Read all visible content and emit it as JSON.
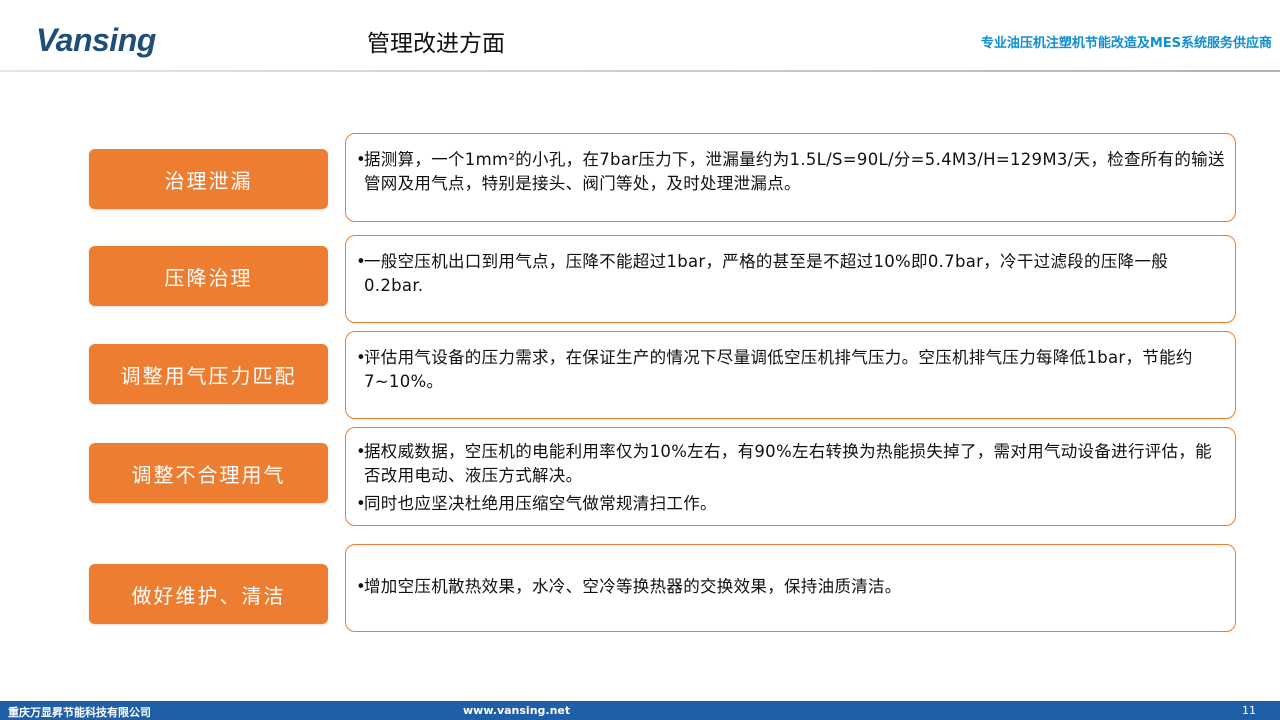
{
  "header": {
    "logo_text": "Vansing",
    "title": "管理改进方面",
    "tagline": "专业油压机注塑机节能改造及MES系统服务供应商"
  },
  "items": [
    {
      "label": "治理泄漏",
      "bullets": [
        "据测算，一个1mm²的小孔，在7bar压力下，泄漏量约为1.5L/S=90L/分=5.4M3/H=129M3/天，检查所有的输送管网及用气点，特别是接头、阀门等处，及时处理泄漏点。"
      ]
    },
    {
      "label": "压降治理",
      "bullets": [
        "一般空压机出口到用气点，压降不能超过1bar，严格的甚至是不超过10%即0.7bar，冷干过滤段的压降一般0.2bar."
      ]
    },
    {
      "label": "调整用气压力匹配",
      "bullets": [
        "评估用气设备的压力需求，在保证生产的情况下尽量调低空压机排气压力。空压机排气压力每降低1bar，节能约7~10%。"
      ]
    },
    {
      "label": "调整不合理用气",
      "bullets": [
        "据权威数据，空压机的电能利用率仅为10%左右，有90%左右转换为热能损失掉了，需对用气动设备进行评估，能否改用电动、液压方式解决。",
        "同时也应坚决杜绝用压缩空气做常规清扫工作。"
      ]
    },
    {
      "label": "做好维护、清洁",
      "bullets": [
        "增加空压机散热效果，水冷、空冷等换热器的交换效果，保持油质清洁。"
      ]
    }
  ],
  "footer": {
    "company": "重庆万显昇节能科技有限公司",
    "website": "www.vansing.net",
    "page_number": "11"
  }
}
